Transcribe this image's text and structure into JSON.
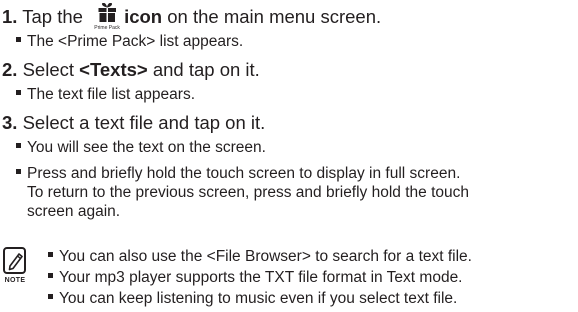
{
  "steps": [
    {
      "number": "1.",
      "text_before": " Tap the ",
      "icon_caption": "Prime Pack",
      "bold_text": "icon",
      "text_after": " on the main menu screen.",
      "bullets": [
        "The <Prime Pack> list appears."
      ]
    },
    {
      "number": "2.",
      "text_before": " Select ",
      "bold_text": "<Texts>",
      "text_after": " and tap on it.",
      "bullets": [
        "The text file list appears."
      ]
    },
    {
      "number": "3.",
      "text": " Select a text file and tap on it.",
      "bullets": [
        "You will see the text on the screen.",
        "Press and briefly hold the touch screen to display in full screen."
      ],
      "bullet2_continuation": [
        "To return to the previous screen, press and briefly hold the touch",
        "screen again."
      ]
    }
  ],
  "note": {
    "label": "NOTE",
    "items": [
      "You can also use the <File Browser> to search for a text file.",
      "Your mp3 player supports the TXT file format in Text mode.",
      "You can keep listening to music even if you select text file."
    ]
  }
}
